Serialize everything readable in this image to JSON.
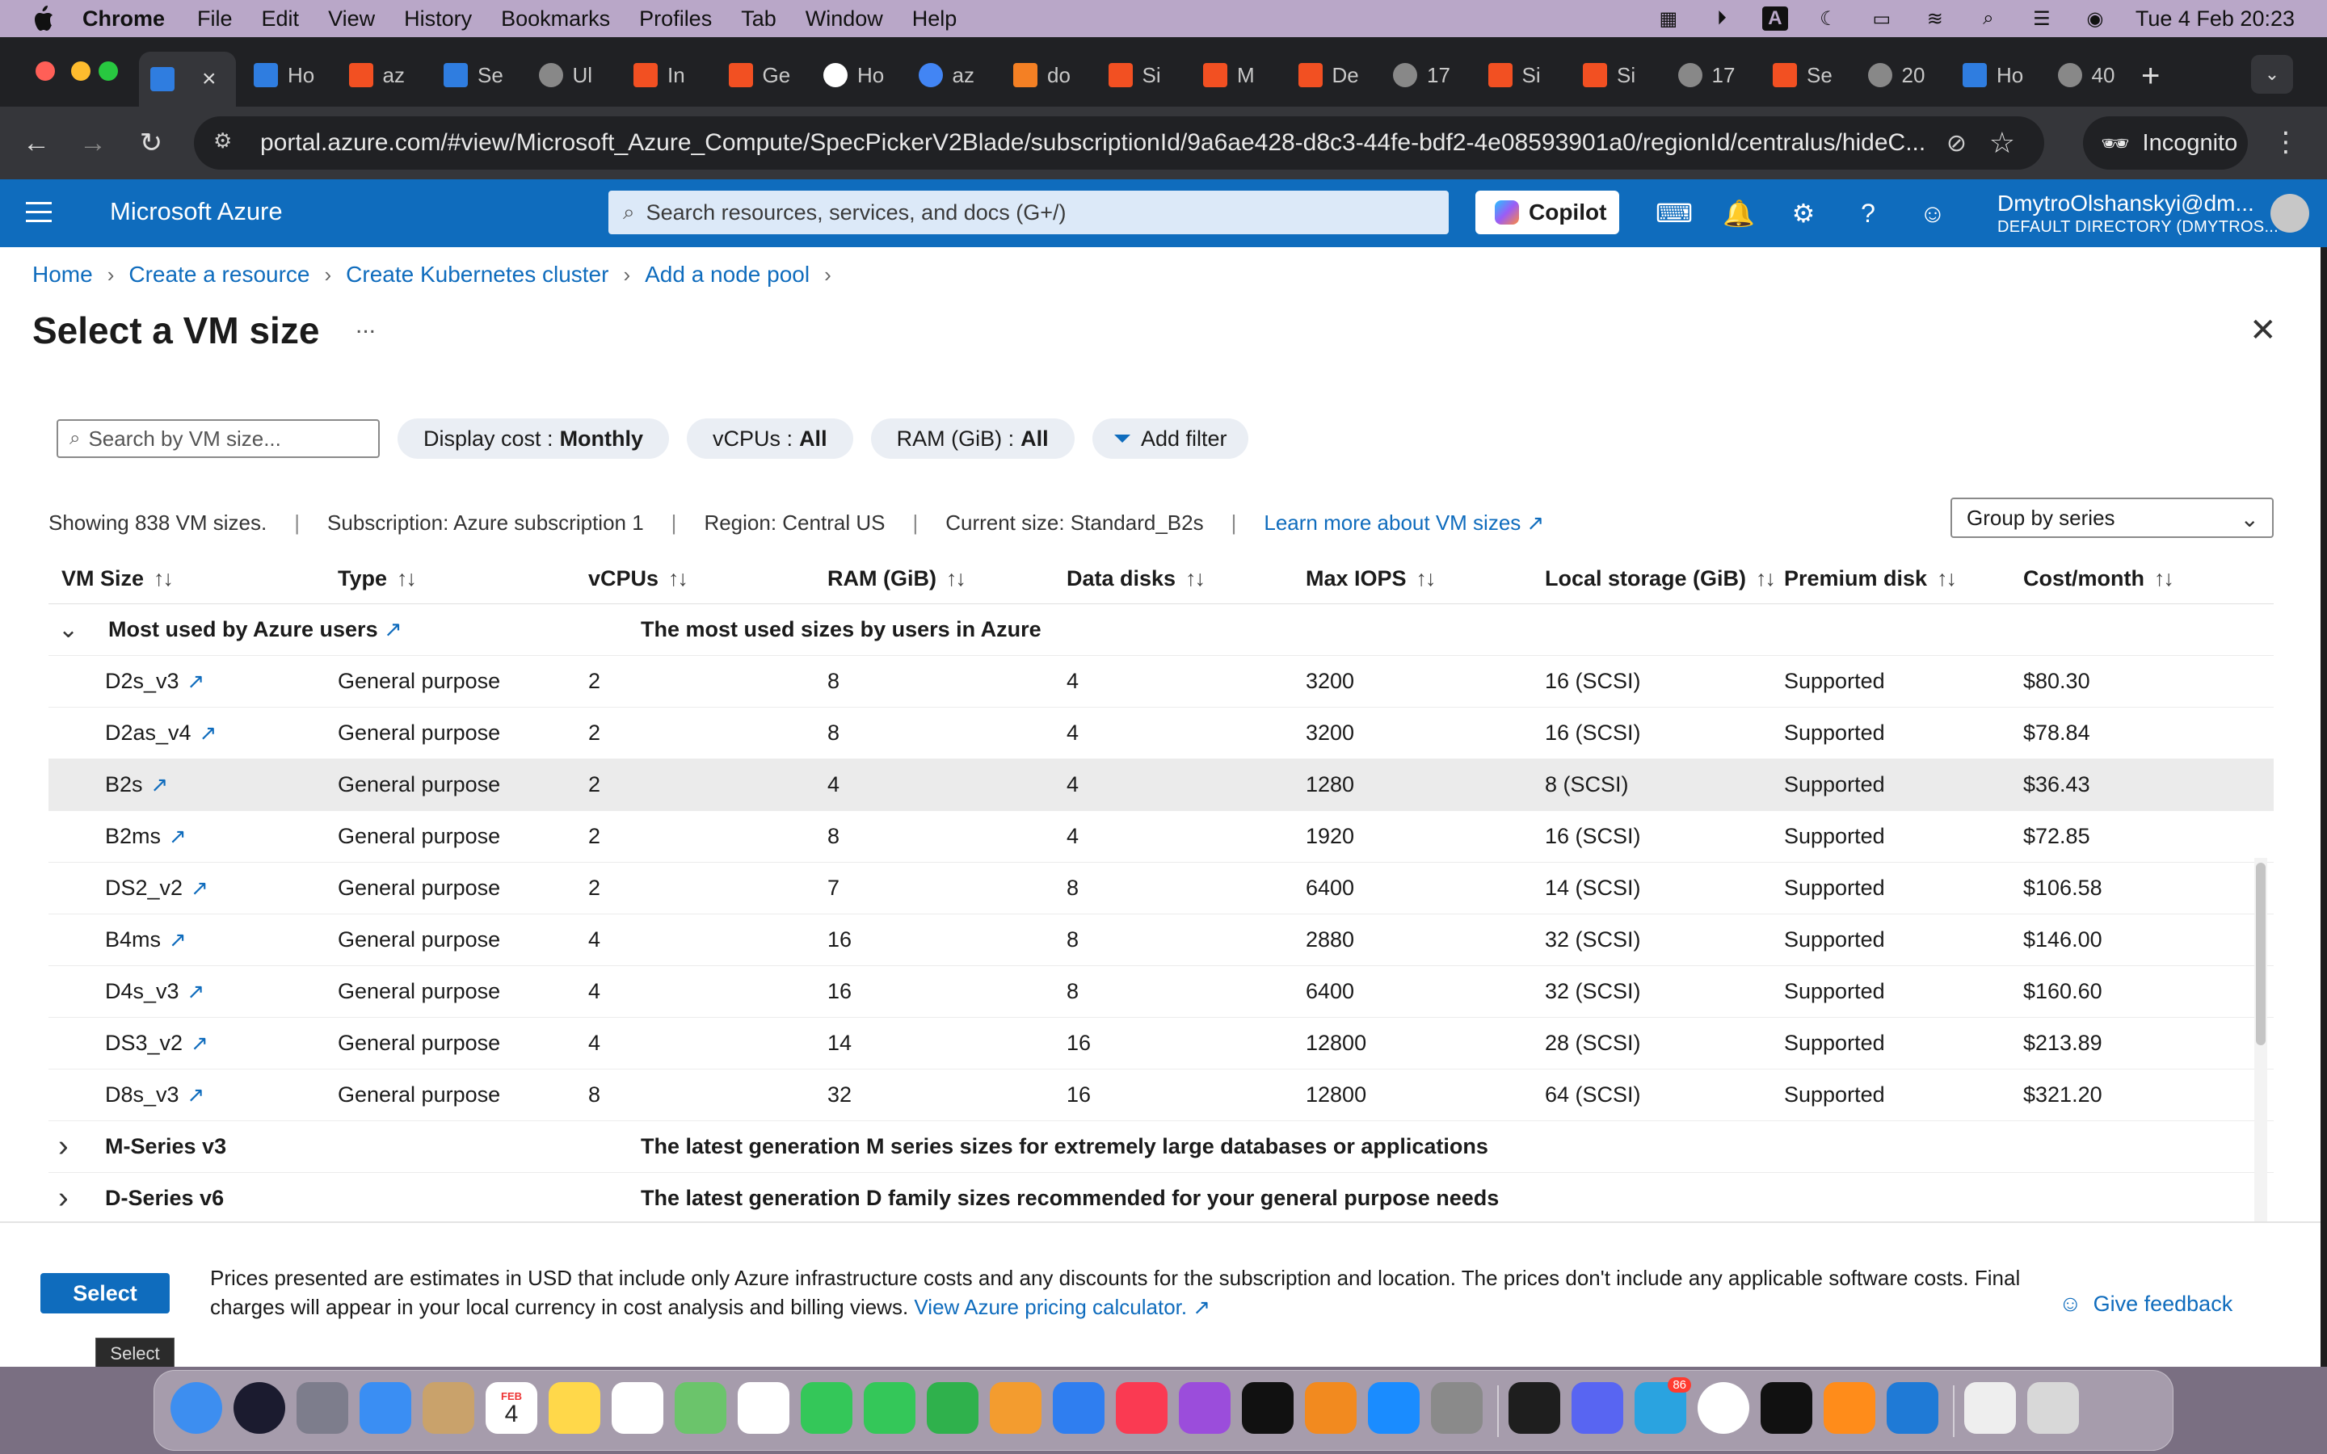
{
  "menubar": {
    "app": "Chrome",
    "items": [
      "File",
      "Edit",
      "View",
      "History",
      "Bookmarks",
      "Profiles",
      "Tab",
      "Window",
      "Help"
    ],
    "clock": "Tue 4 Feb  20:23",
    "status_icons": [
      "cpu-meter-icon",
      "play-icon",
      "keyboard-input-icon",
      "moon-icon",
      "battery-icon",
      "wifi-icon",
      "spotlight-icon",
      "control-center-icon",
      "siri-icon"
    ]
  },
  "tabs": [
    {
      "label": "",
      "icon": "azure-icon",
      "active": true
    },
    {
      "label": "Ho",
      "icon": "azure-icon"
    },
    {
      "label": "az",
      "icon": "microsoft-icon"
    },
    {
      "label": "Se",
      "icon": "azure-icon"
    },
    {
      "label": "Ul",
      "icon": "globe-icon"
    },
    {
      "label": "In",
      "icon": "microsoft-icon"
    },
    {
      "label": "Ge",
      "icon": "microsoft-icon"
    },
    {
      "label": "Ho",
      "icon": "github-icon"
    },
    {
      "label": "az",
      "icon": "google-icon"
    },
    {
      "label": "do",
      "icon": "stackoverflow-icon"
    },
    {
      "label": "Si",
      "icon": "microsoft-icon"
    },
    {
      "label": "M",
      "icon": "microsoft-icon"
    },
    {
      "label": "De",
      "icon": "microsoft-icon"
    },
    {
      "label": "17",
      "icon": "globe-icon"
    },
    {
      "label": "Si",
      "icon": "microsoft-icon"
    },
    {
      "label": "Si",
      "icon": "microsoft-icon"
    },
    {
      "label": "17",
      "icon": "globe-icon"
    },
    {
      "label": "Se",
      "icon": "microsoft-icon"
    },
    {
      "label": "20",
      "icon": "globe-icon"
    },
    {
      "label": "Ho",
      "icon": "azure-icon"
    },
    {
      "label": "40",
      "icon": "globe-icon"
    }
  ],
  "address": {
    "url": "portal.azure.com/#view/Microsoft_Azure_Compute/SpecPickerV2Blade/subscriptionId/9a6ae428-d8c3-44fe-bdf2-4e08593901a0/regionId/centralus/hideC...",
    "incognito_label": "Incognito"
  },
  "azure": {
    "brand": "Microsoft Azure",
    "search_placeholder": "Search resources, services, and docs (G+/)",
    "copilot_label": "Copilot",
    "user_name": "DmytroOlshanskyi@dm...",
    "directory": "DEFAULT DIRECTORY (DMYTROS..."
  },
  "breadcrumb": [
    "Home",
    "Create a resource",
    "Create Kubernetes cluster",
    "Add a node pool"
  ],
  "page": {
    "title": "Select a VM size",
    "more": "...",
    "close": "✕"
  },
  "filters": {
    "search_placeholder": "Search by VM size...",
    "display_cost_label": "Display cost :",
    "display_cost_value": "Monthly",
    "vcpus_label": "vCPUs :",
    "vcpus_value": "All",
    "ram_label": "RAM (GiB) :",
    "ram_value": "All",
    "add_filter": "Add filter"
  },
  "info": {
    "showing": "Showing 838 VM sizes.",
    "subscription": "Subscription: Azure subscription 1",
    "region": "Region: Central US",
    "current": "Current size: Standard_B2s",
    "learn_more": "Learn more about VM sizes",
    "group_by": "Group by series"
  },
  "table": {
    "headers": [
      "VM Size",
      "Type",
      "vCPUs",
      "RAM (GiB)",
      "Data disks",
      "Max IOPS",
      "Local storage (GiB)",
      "Premium disk",
      "Cost/month"
    ],
    "group": {
      "name": "Most used by Azure users",
      "description": "The most used sizes by users in Azure"
    },
    "rows": [
      {
        "size": "D2s_v3",
        "type": "General purpose",
        "vcpus": "2",
        "ram": "8",
        "disks": "4",
        "iops": "3200",
        "storage": "16 (SCSI)",
        "premium": "Supported",
        "cost": "$80.30"
      },
      {
        "size": "D2as_v4",
        "type": "General purpose",
        "vcpus": "2",
        "ram": "8",
        "disks": "4",
        "iops": "3200",
        "storage": "16 (SCSI)",
        "premium": "Supported",
        "cost": "$78.84"
      },
      {
        "size": "B2s",
        "type": "General purpose",
        "vcpus": "2",
        "ram": "4",
        "disks": "4",
        "iops": "1280",
        "storage": "8 (SCSI)",
        "premium": "Supported",
        "cost": "$36.43",
        "selected": true
      },
      {
        "size": "B2ms",
        "type": "General purpose",
        "vcpus": "2",
        "ram": "8",
        "disks": "4",
        "iops": "1920",
        "storage": "16 (SCSI)",
        "premium": "Supported",
        "cost": "$72.85"
      },
      {
        "size": "DS2_v2",
        "type": "General purpose",
        "vcpus": "2",
        "ram": "7",
        "disks": "8",
        "iops": "6400",
        "storage": "14 (SCSI)",
        "premium": "Supported",
        "cost": "$106.58"
      },
      {
        "size": "B4ms",
        "type": "General purpose",
        "vcpus": "4",
        "ram": "16",
        "disks": "8",
        "iops": "2880",
        "storage": "32 (SCSI)",
        "premium": "Supported",
        "cost": "$146.00"
      },
      {
        "size": "D4s_v3",
        "type": "General purpose",
        "vcpus": "4",
        "ram": "16",
        "disks": "8",
        "iops": "6400",
        "storage": "32 (SCSI)",
        "premium": "Supported",
        "cost": "$160.60"
      },
      {
        "size": "DS3_v2",
        "type": "General purpose",
        "vcpus": "4",
        "ram": "14",
        "disks": "16",
        "iops": "12800",
        "storage": "28 (SCSI)",
        "premium": "Supported",
        "cost": "$213.89"
      },
      {
        "size": "D8s_v3",
        "type": "General purpose",
        "vcpus": "8",
        "ram": "32",
        "disks": "16",
        "iops": "12800",
        "storage": "64 (SCSI)",
        "premium": "Supported",
        "cost": "$321.20"
      }
    ],
    "collapsed_groups": [
      {
        "name": "M-Series v3",
        "description": "The latest generation M series sizes for extremely large databases or applications"
      },
      {
        "name": "D-Series v6",
        "description": "The latest generation D family sizes recommended for your general purpose needs"
      }
    ]
  },
  "footer": {
    "select_label": "Select",
    "note": "Prices presented are estimates in USD that include only Azure infrastructure costs and any discounts for the subscription and location. The prices don't include any applicable software costs. Final charges will appear in your local currency in cost analysis and billing views.",
    "pricing_link": "View Azure pricing calculator.",
    "feedback": "Give feedback",
    "tooltip": "Select"
  },
  "dock": {
    "apps": [
      "finder-icon",
      "siri-icon",
      "launchpad-icon",
      "mail-icon",
      "contacts-icon",
      "calendar-icon",
      "notes-icon",
      "reminders-icon",
      "maps-icon",
      "photos-icon",
      "messages-icon",
      "facetime-icon",
      "numbers-icon",
      "pages-icon",
      "keynote-icon",
      "music-icon",
      "podcasts-icon",
      "tv-icon",
      "books-icon",
      "app-store-icon",
      "system-settings-icon",
      "activity-monitor-icon",
      "discord-icon",
      "telegram-icon",
      "chrome-icon",
      "terminal-icon",
      "sublime-icon",
      "vscode-icon",
      "downloads-icon",
      "trash-icon"
    ],
    "calendar_month": "FEB",
    "calendar_day": "4",
    "telegram_badge": "86"
  }
}
